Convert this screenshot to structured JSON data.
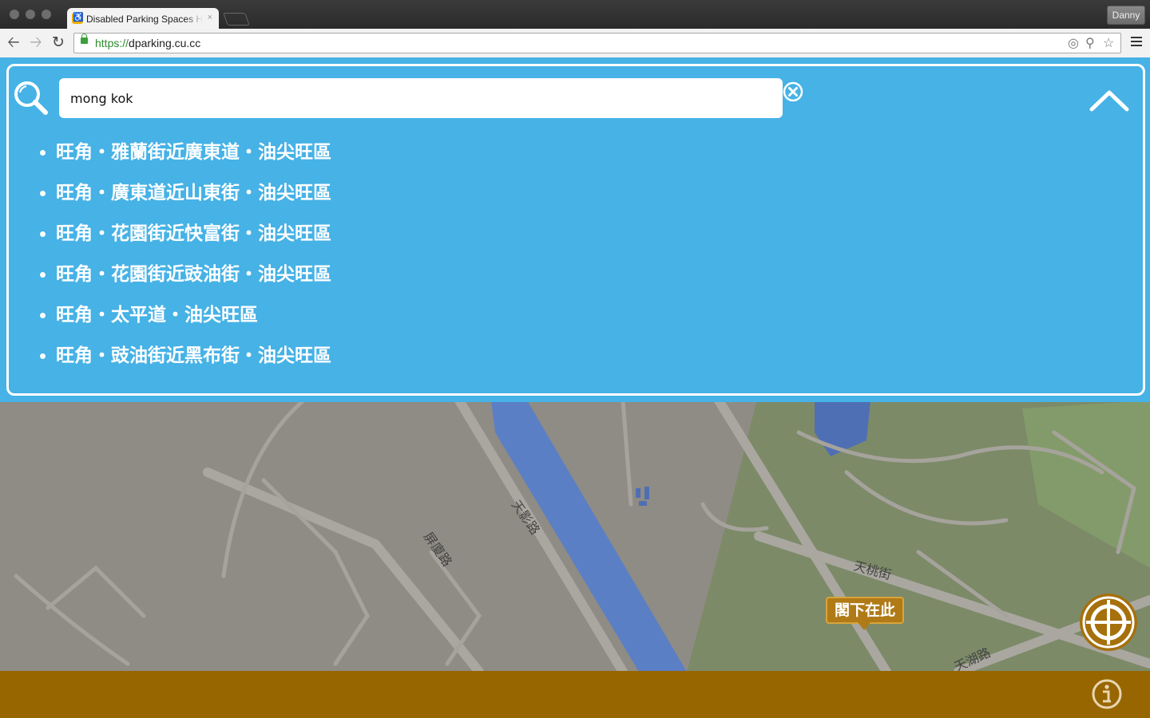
{
  "browser": {
    "tab_title": "Disabled Parking Spaces H",
    "tab_close": "×",
    "profile_name": "Danny",
    "url_scheme": "https://",
    "url_host": "dparking.cu.cc"
  },
  "search": {
    "query": "mong kok",
    "results": [
      "旺角・雅蘭街近廣東道・油尖旺區",
      "旺角・廣東道近山東街・油尖旺區",
      "旺角・花園街近快富街・油尖旺區",
      "旺角・花園街近豉油街・油尖旺區",
      "旺角・太平道・油尖旺區",
      "旺角・豉油街近黑布街・油尖旺區"
    ]
  },
  "map": {
    "road_labels": [
      "天影路",
      "屏廈路",
      "天桃街",
      "天湖路"
    ],
    "current_location_label": "閣下在此"
  },
  "colors": {
    "panel_blue": "#46b2e6",
    "bottom_bar": "#986600",
    "accent_gold": "#b07a16"
  },
  "icons": [
    "search-icon",
    "clear-icon",
    "collapse-icon",
    "locate-icon",
    "info-icon"
  ]
}
